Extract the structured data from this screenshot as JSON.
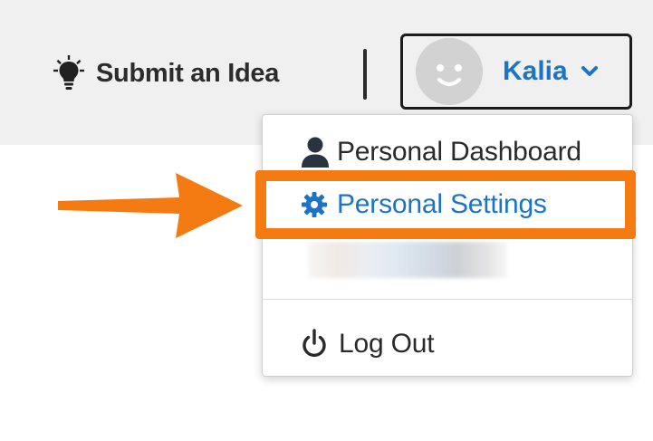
{
  "header": {
    "submit_idea_label": "Submit an Idea",
    "user_name": "Kalia"
  },
  "user_menu": {
    "items": [
      {
        "label": "Personal Dashboard",
        "icon": "user-icon"
      },
      {
        "label": "Personal Settings",
        "icon": "gear-icon"
      },
      {
        "label": "",
        "icon": "",
        "note_redacted": true
      },
      {
        "label": "Log Out",
        "icon": "power-icon"
      }
    ]
  },
  "annotation": {
    "highlight_color": "#f47b12",
    "arrow_color": "#f47b12",
    "highlighted_item": "Personal Settings"
  },
  "colors": {
    "accent": "#1d74c7",
    "header_bg": "#f0f0f0",
    "text_dark": "#2a2a2a"
  }
}
